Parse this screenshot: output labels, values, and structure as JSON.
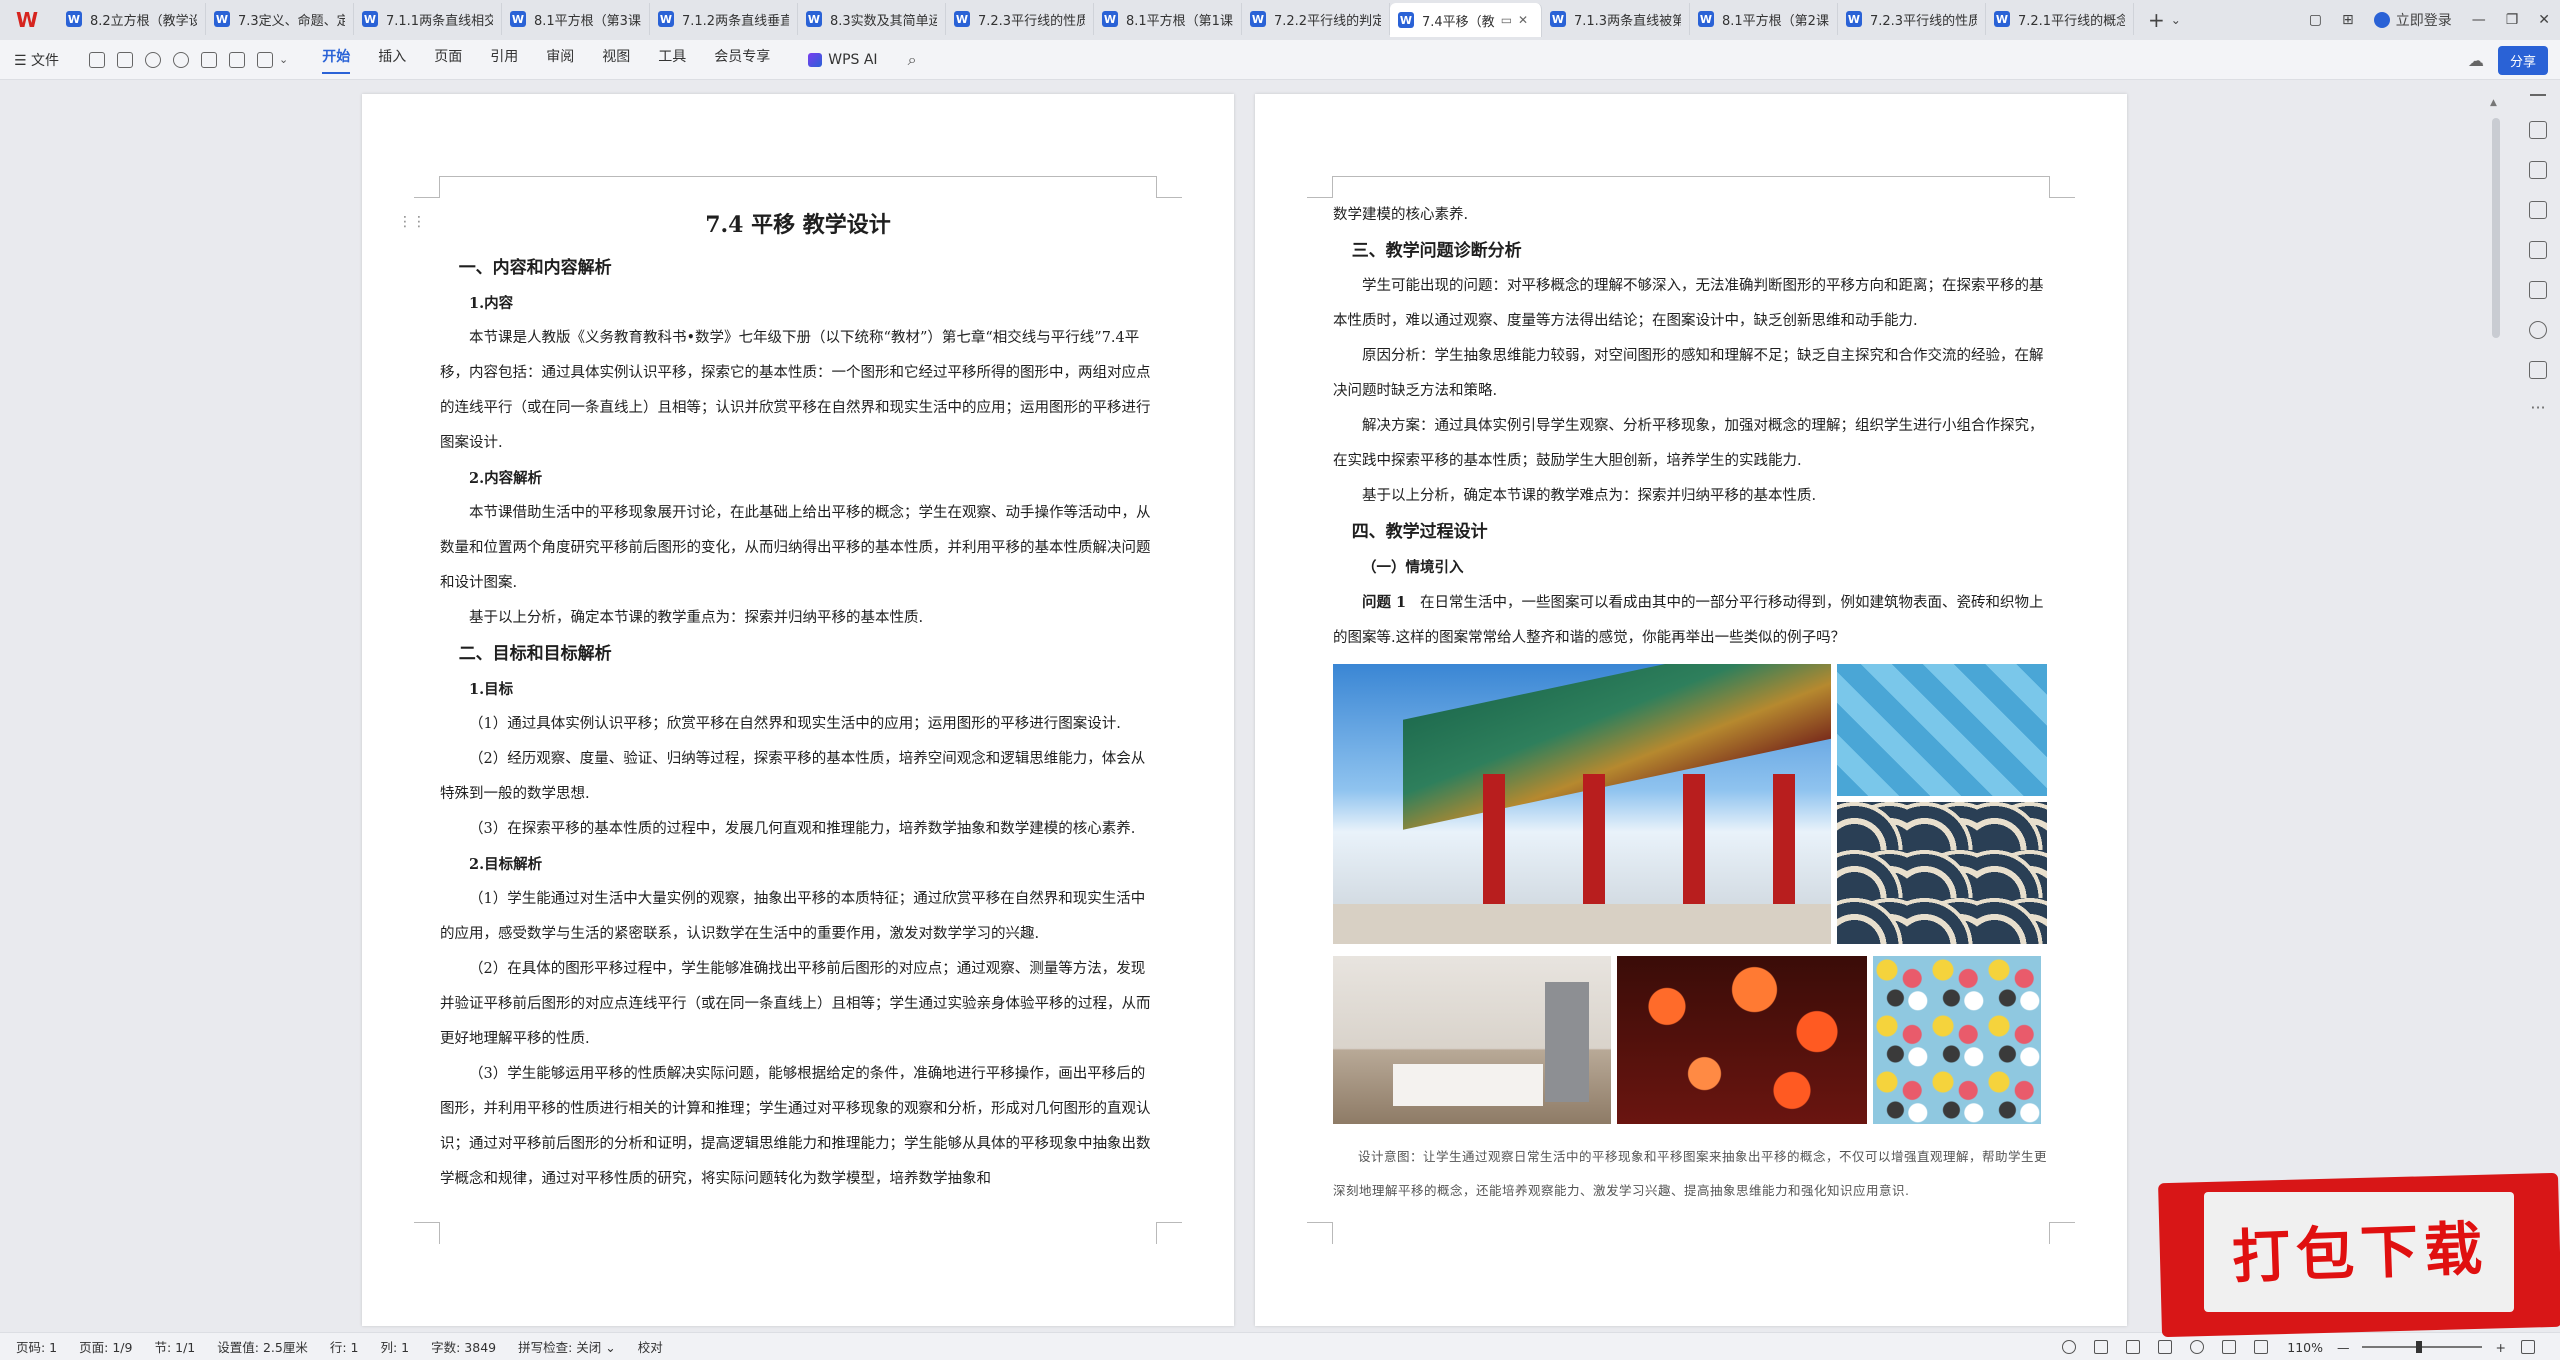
{
  "tabs": [
    {
      "label": "8.2立方根（教学设计",
      "active": false
    },
    {
      "label": "7.3定义、命题、定理",
      "active": false
    },
    {
      "label": "7.1.1两条直线相交",
      "active": false
    },
    {
      "label": "8.1平方根（第3课时",
      "active": false
    },
    {
      "label": "7.1.2两条直线垂直",
      "active": false
    },
    {
      "label": "8.3实数及其简单运算",
      "active": false
    },
    {
      "label": "7.2.3平行线的性质",
      "active": false
    },
    {
      "label": "8.1平方根（第1课时",
      "active": false
    },
    {
      "label": "7.2.2平行线的判定",
      "active": false
    },
    {
      "label": "7.4平移（教",
      "active": true
    },
    {
      "label": "7.1.3两条直线被第三",
      "active": false
    },
    {
      "label": "8.1平方根（第2课时",
      "active": false
    },
    {
      "label": "7.2.3平行线的性质",
      "active": false
    },
    {
      "label": "7.2.1平行线的概念",
      "active": false
    }
  ],
  "topbar": {
    "login": "立即登录",
    "share": "分享"
  },
  "ribbon": {
    "file": "☰ 文件",
    "menus": [
      "开始",
      "插入",
      "页面",
      "引用",
      "审阅",
      "视图",
      "工具",
      "会员专享"
    ],
    "active_menu": "开始",
    "wps_ai": "WPS AI"
  },
  "left_page": {
    "title": "7.4  平移  教学设计",
    "s1": "一、内容和内容解析",
    "s1_1": "1.内容",
    "s1_1_p": "本节课是人教版《义务教育教科书•数学》七年级下册（以下统称“教材”）第七章“相交线与平行线”7.4平移，内容包括：通过具体实例认识平移，探索它的基本性质：一个图形和它经过平移所得的图形中，两组对应点的连线平行（或在同一条直线上）且相等；认识并欣赏平移在自然界和现实生活中的应用；运用图形的平移进行图案设计.",
    "s1_2": "2.内容解析",
    "s1_2_p": "本节课借助生活中的平移现象展开讨论，在此基础上给出平移的概念；学生在观察、动手操作等活动中，从数量和位置两个角度研究平移前后图形的变化，从而归纳得出平移的基本性质，并利用平移的基本性质解决问题和设计图案.",
    "s1_3_p": "基于以上分析，确定本节课的教学重点为：探索并归纳平移的基本性质.",
    "s2": "二、目标和目标解析",
    "s2_1": "1.目标",
    "s2_1_a": "（1）通过具体实例认识平移；欣赏平移在自然界和现实生活中的应用；运用图形的平移进行图案设计.",
    "s2_1_b": "（2）经历观察、度量、验证、归纳等过程，探索平移的基本性质，培养空间观念和逻辑思维能力，体会从特殊到一般的数学思想.",
    "s2_1_c": "（3）在探索平移的基本性质的过程中，发展几何直观和推理能力，培养数学抽象和数学建模的核心素养.",
    "s2_2": "2.目标解析",
    "s2_2_a": "（1）学生能通过对生活中大量实例的观察，抽象出平移的本质特征；通过欣赏平移在自然界和现实生活中的应用，感受数学与生活的紧密联系，认识数学在生活中的重要作用，激发对数学学习的兴趣.",
    "s2_2_b": "（2）在具体的图形平移过程中，学生能够准确找出平移前后图形的对应点；通过观察、测量等方法，发现并验证平移前后图形的对应点连线平行（或在同一条直线上）且相等；学生通过实验亲身体验平移的过程，从而更好地理解平移的性质.",
    "s2_2_c": "（3）学生能够运用平移的性质解决实际问题，能够根据给定的条件，准确地进行平移操作，画出平移后的图形，并利用平移的性质进行相关的计算和推理；学生通过对平移现象的观察和分析，形成对几何图形的直观认识；通过对平移前后图形的分析和证明，提高逻辑思维能力和推理能力；学生能够从具体的平移现象中抽象出数学概念和规律，通过对平移性质的研究，将实际问题转化为数学模型，培养数学抽象和"
  },
  "right_page": {
    "p0": "数学建模的核心素养.",
    "s3": "三、教学问题诊断分析",
    "s3_a": "学生可能出现的问题：对平移概念的理解不够深入，无法准确判断图形的平移方向和距离；在探索平移的基本性质时，难以通过观察、度量等方法得出结论；在图案设计中，缺乏创新思维和动手能力.",
    "s3_b": "原因分析：学生抽象思维能力较弱，对空间图形的感知和理解不足；缺乏自主探究和合作交流的经验，在解决问题时缺乏方法和策略.",
    "s3_c": "解决方案：通过具体实例引导学生观察、分析平移现象，加强对概念的理解；组织学生进行小组合作探究，在实践中探索平移的基本性质；鼓励学生大胆创新，培养学生的实践能力.",
    "s3_d": "基于以上分析，确定本节课的教学难点为：探索并归纳平移的基本性质.",
    "s4": "四、教学过程设计",
    "s4_1": "（一）情境引入",
    "q1_label": "问题 1",
    "q1_text": "在日常生活中，一些图案可以看成由其中的一部分平行移动得到，例如建筑物表面、瓷砖和织物上的图案等.这样的图案常常给人整齐和谐的感觉，你能再举出一些类似的例子吗？",
    "note": "设计意图：让学生通过观察日常生活中的平移现象和平移图案来抽象出平移的概念，不仅可以增强直观理解，帮助学生更深刻地理解平移的概念，还能培养观察能力、激发学习兴趣、提高抽象思维能力和强化知识应用意识."
  },
  "statusbar": {
    "page_code": "页码: 1",
    "pages": "页面: 1/9",
    "section": "节: 1/1",
    "setting": "设置值: 2.5厘米",
    "row": "行: 1",
    "col": "列: 1",
    "words": "字数: 3849",
    "spell": "拼写检查: 关闭 ⌄",
    "proof": "校对",
    "zoom": "110%"
  },
  "banner": {
    "text": "打包下载"
  },
  "colors": {
    "accent": "#2a62d6",
    "brand_red": "#d6241f",
    "banner_red": "#d81617"
  }
}
